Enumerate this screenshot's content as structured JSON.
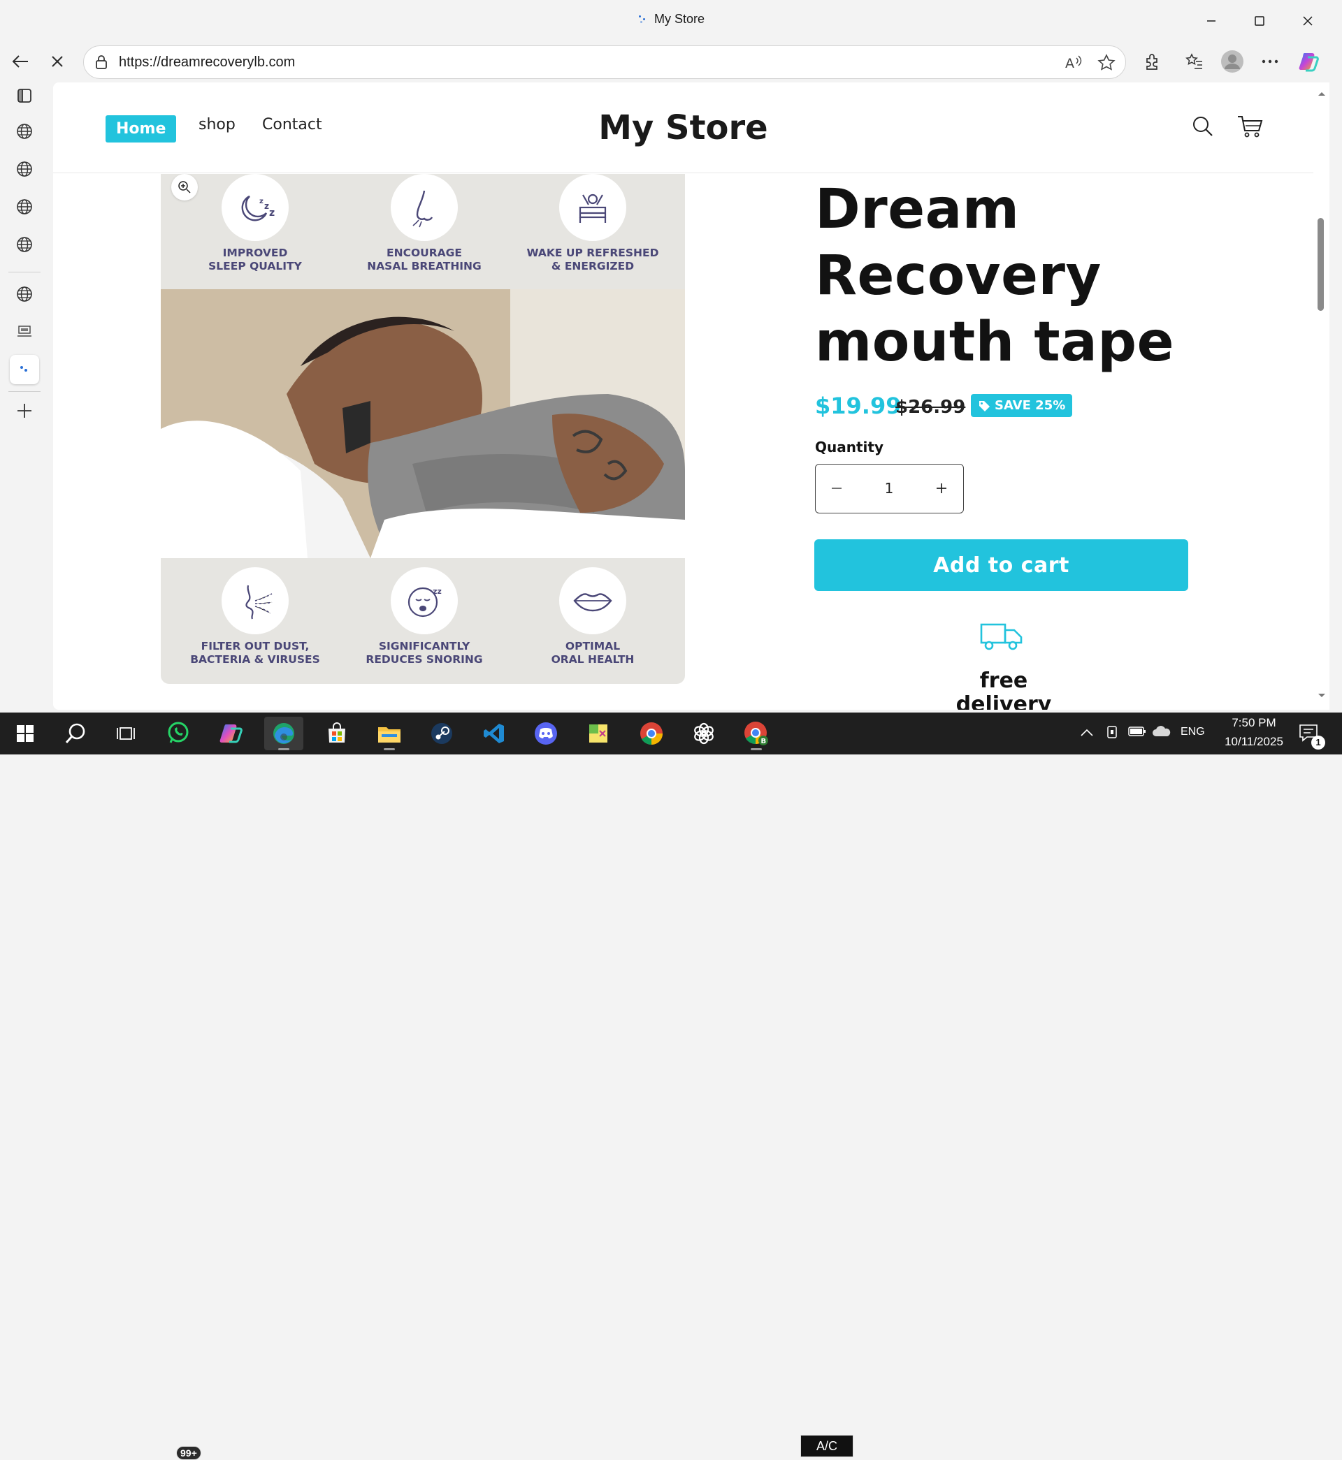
{
  "window": {
    "title": "My Store"
  },
  "browser": {
    "url": "https://dreamrecoverylb.com"
  },
  "store": {
    "nav": {
      "home": "Home",
      "shop": "shop",
      "contact": "Contact"
    },
    "title": "My Store"
  },
  "product": {
    "title": "Dream Recovery mouth tape",
    "price": "$19.99",
    "compare_price": "$26.99",
    "save_badge": "SAVE 25%",
    "quantity_label": "Quantity",
    "quantity": "1",
    "add_to_cart": "Add to cart",
    "delivery": "free delivery",
    "image_features_top": [
      {
        "line1": "IMPROVED",
        "line2": "SLEEP QUALITY"
      },
      {
        "line1": "ENCOURAGE",
        "line2": "NASAL BREATHING"
      },
      {
        "line1": "WAKE UP REFRESHED",
        "line2": "& ENERGIZED"
      }
    ],
    "image_features_bottom": [
      {
        "line1": "FILTER OUT DUST,",
        "line2": "BACTERIA & VIRUSES"
      },
      {
        "line1": "SIGNIFICANTLY",
        "line2": "REDUCES SNORING"
      },
      {
        "line1": "OPTIMAL",
        "line2": "ORAL HEALTH"
      }
    ]
  },
  "taskbar": {
    "whatsapp_badge": "99+",
    "ac_label": "A/C",
    "language": "ENG",
    "time": "7:50 PM",
    "date": "10/11/2025",
    "notifications": "1"
  },
  "colors": {
    "accent": "#22c3dd",
    "feature_text": "#4a4777"
  }
}
